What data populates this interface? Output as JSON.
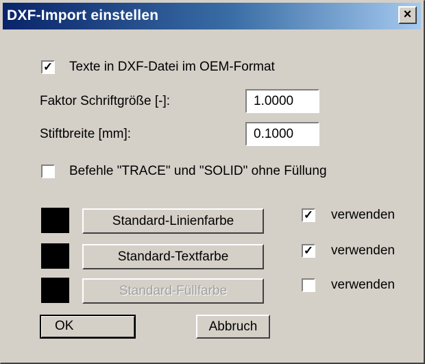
{
  "window": {
    "title": "DXF-Import einstellen",
    "close_glyph": "×"
  },
  "options": {
    "oem_format": {
      "label": "Texte in DXF-Datei im OEM-Format",
      "checked": true
    },
    "font_factor": {
      "label": "Faktor Schriftgröße [-]:",
      "value": "1.0000"
    },
    "pen_width": {
      "label": "Stiftbreite [mm]:",
      "value": "0.1000"
    },
    "trace_solid": {
      "label": "Befehle \"TRACE\" und \"SOLID\" ohne Füllung",
      "checked": false
    }
  },
  "colors": [
    {
      "button_label": "Standard-Linienfarbe",
      "swatch_color": "#000000",
      "enabled": true,
      "use_label": "verwenden",
      "use_checked": true
    },
    {
      "button_label": "Standard-Textfarbe",
      "swatch_color": "#000000",
      "enabled": true,
      "use_label": "verwenden",
      "use_checked": true
    },
    {
      "button_label": "Standard-Füllfarbe",
      "swatch_color": "#000000",
      "enabled": false,
      "use_label": "verwenden",
      "use_checked": false
    }
  ],
  "buttons": {
    "ok": "OK",
    "cancel": "Abbruch"
  },
  "theme": {
    "face": "#d4d0c8",
    "title_start": "#0a246a",
    "title_end": "#a6caf0"
  }
}
